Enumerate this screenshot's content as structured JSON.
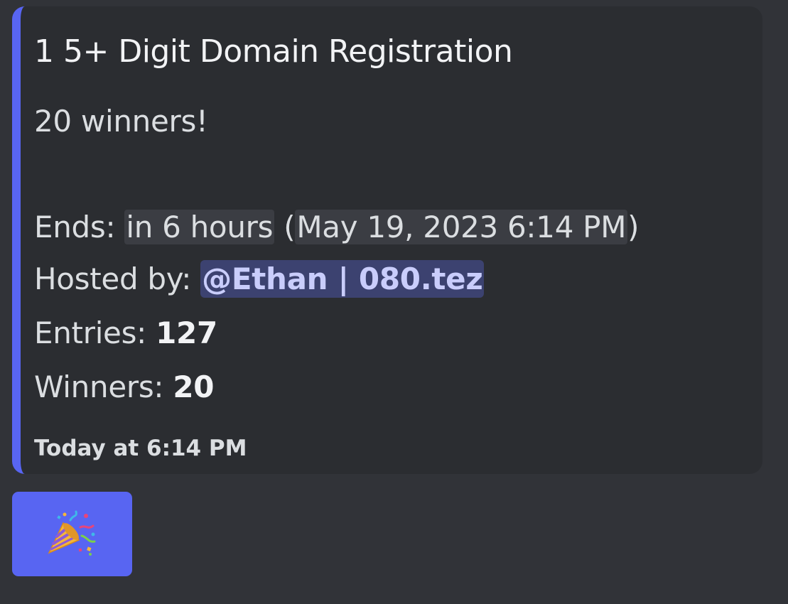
{
  "embed": {
    "title": "1 5+ Digit Domain Registration",
    "winners_note": "20 winners!",
    "ends_label": "Ends: ",
    "ends_relative": "in 6 hours",
    "ends_open_paren": " (",
    "ends_absolute": "May 19, 2023 6:14 PM",
    "ends_close_paren": ")",
    "hosted_label": "Hosted by: ",
    "host_mention": "@Ethan | 080.tez",
    "entries_label": "Entries: ",
    "entries_value": "127",
    "winners_label": "Winners: ",
    "winners_value": "20",
    "footer_timestamp": "Today at 6:14 PM",
    "accent_color": "#5865f2"
  },
  "reaction": {
    "icon": "party-popper-icon",
    "background_color": "#5865f2"
  }
}
